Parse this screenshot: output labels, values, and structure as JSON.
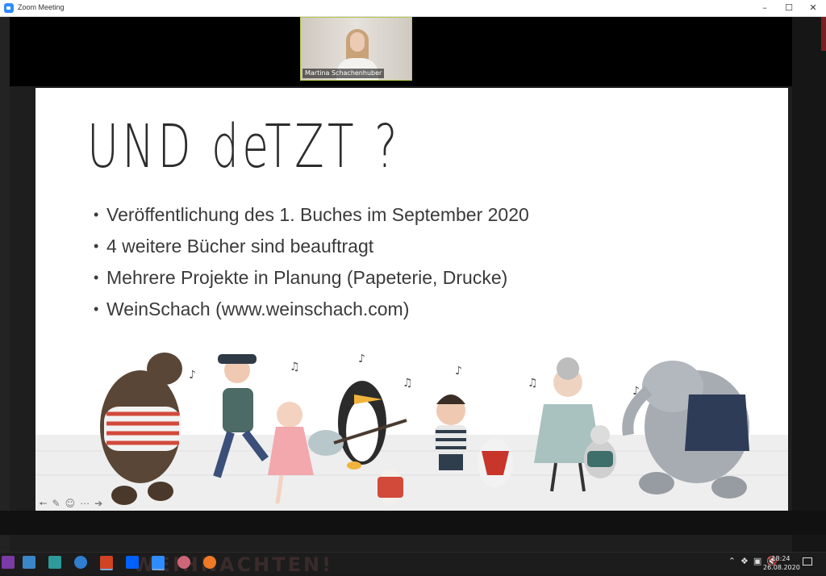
{
  "window": {
    "title": "Zoom Meeting",
    "min_icon": "minimize-icon",
    "max_icon": "maximize-icon",
    "close_icon": "close-icon"
  },
  "video": {
    "participant_name": "Martina Schachenhuber"
  },
  "slide": {
    "title": "UND deTZT ?",
    "bullets": [
      "Veröffentlichung des 1. Buches im September 2020",
      "4 weitere Bücher sind beauftragt",
      "Mehrere Projekte in Planung (Papeterie, Drucke)",
      "WeinSchach (www.weinschach.com)"
    ],
    "tools": [
      "arrow-left-icon",
      "pen-icon",
      "smiley-icon",
      "more-icon",
      "arrow-right-icon"
    ]
  },
  "taskbar": {
    "background_text": "WEIHNACHTEN!",
    "clock_time": "18:24",
    "clock_date": "26.08.2020",
    "icons": [
      "onenote-icon",
      "files-icon",
      "app-icon",
      "edge-icon",
      "powerpoint-icon",
      "dropbox-icon",
      "zoom-icon",
      "paint-icon",
      "firefox-icon"
    ],
    "tray_icons": [
      "chevron-up-icon",
      "dropbox-icon",
      "network-icon",
      "mute-icon"
    ]
  },
  "colors": {
    "zoom_blue": "#2d8cff",
    "powerpoint_red": "#d04423",
    "slide_text": "#3a3a3a"
  }
}
